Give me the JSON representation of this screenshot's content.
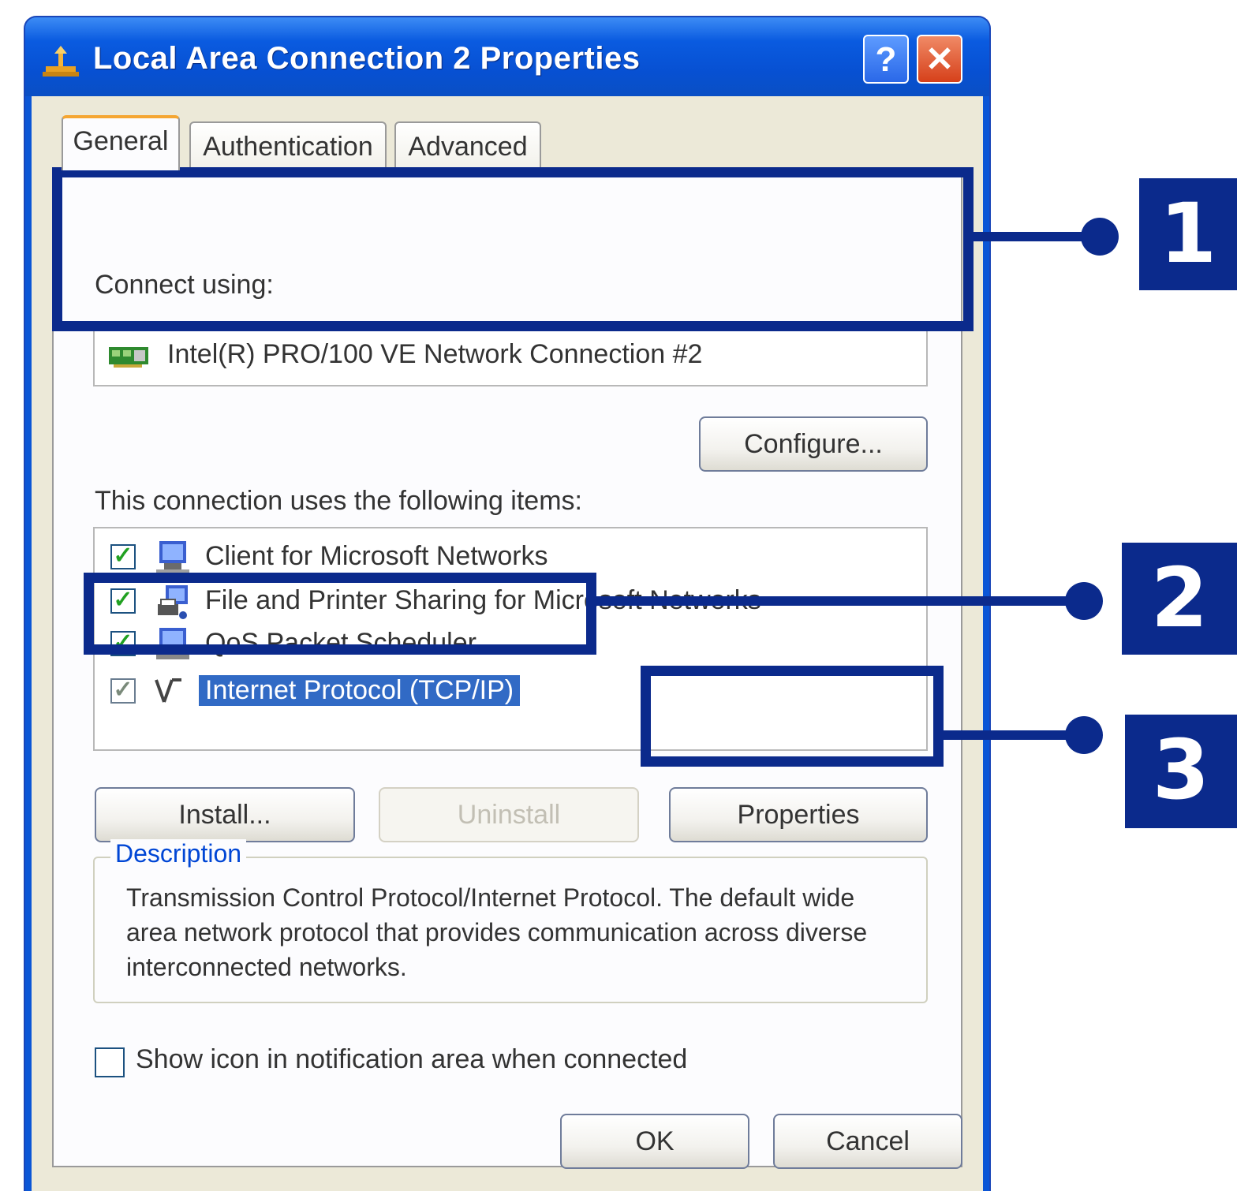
{
  "window": {
    "title": "Local Area Connection 2 Properties",
    "help_label": "?",
    "close_label": "✕"
  },
  "tabs": [
    {
      "label": "General",
      "active": true
    },
    {
      "label": "Authentication",
      "active": false
    },
    {
      "label": "Advanced",
      "active": false
    }
  ],
  "general": {
    "connect_using_label": "Connect using:",
    "device_name": "Intel(R) PRO/100 VE Network Connection #2",
    "configure_button": "Configure...",
    "items_label": "This connection uses the following items:",
    "items": [
      {
        "label": "Client for Microsoft Networks",
        "checked": true,
        "icon": "client-network-icon"
      },
      {
        "label": "File and Printer Sharing for Microsoft Networks",
        "checked": true,
        "icon": "file-printer-sharing-icon"
      },
      {
        "label": "QoS Packet Scheduler",
        "checked": true,
        "icon": "qos-scheduler-icon"
      },
      {
        "label": "Internet Protocol (TCP/IP)",
        "checked": true,
        "selected": true,
        "icon": "protocol-icon"
      }
    ],
    "install_button": "Install...",
    "uninstall_button": "Uninstall",
    "properties_button": "Properties",
    "description_legend": "Description",
    "description_text": "Transmission Control Protocol/Internet Protocol. The default wide area network protocol that provides communication across diverse interconnected networks.",
    "notify_label": "Show icon in notification area when connected",
    "notify_checked": false
  },
  "footer": {
    "ok_button": "OK",
    "cancel_button": "Cancel"
  },
  "callouts": [
    "1",
    "2",
    "3"
  ],
  "colors": {
    "callout": "#0b2a8c",
    "titlebar": "#0a5be0",
    "selection": "#316ac5"
  }
}
